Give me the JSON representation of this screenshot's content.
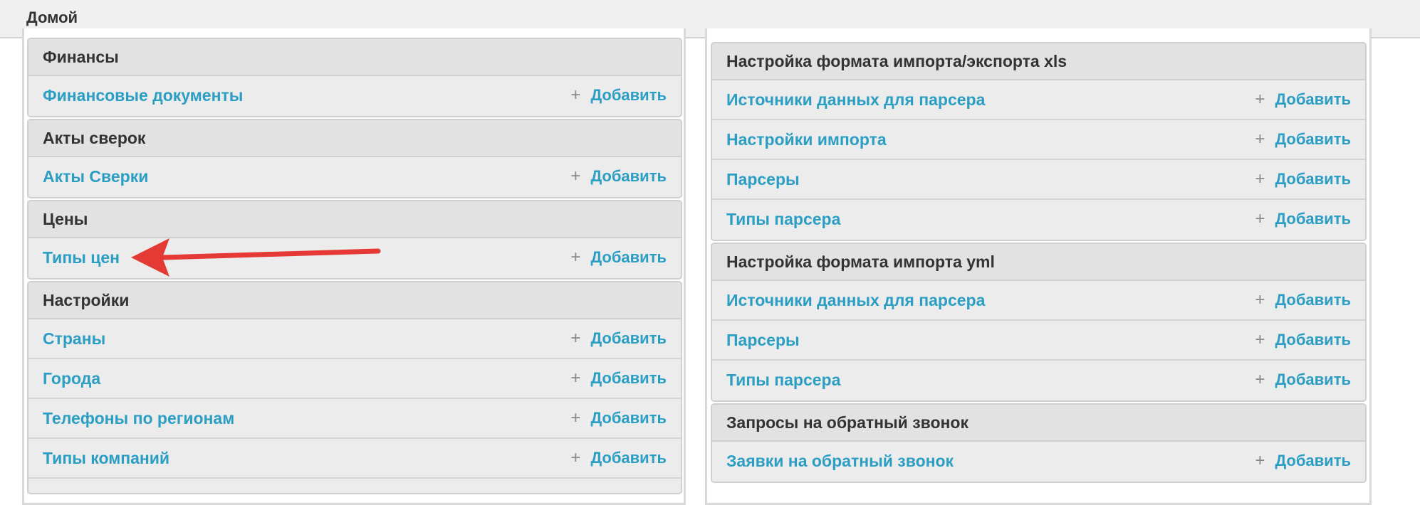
{
  "breadcrumb": "Домой",
  "add_label": "Добавить",
  "left": {
    "modules": [
      {
        "title": "Финансы",
        "rows": [
          "Финансовые документы"
        ]
      },
      {
        "title": "Акты сверок",
        "rows": [
          "Акты Сверки"
        ]
      },
      {
        "title": "Цены",
        "rows": [
          "Типы цен"
        ]
      },
      {
        "title": "Настройки",
        "rows": [
          "Страны",
          "Города",
          "Телефоны по регионам",
          "Типы компаний"
        ]
      }
    ]
  },
  "right": {
    "modules": [
      {
        "title": "Настройка формата импорта/экспорта xls",
        "rows": [
          "Источники данных для парсера",
          "Настройки импорта",
          "Парсеры",
          "Типы парсера"
        ]
      },
      {
        "title": "Настройка формата импорта yml",
        "rows": [
          "Источники данных для парсера",
          "Парсеры",
          "Типы парсера"
        ]
      },
      {
        "title": "Запросы на обратный звонок",
        "rows": [
          "Заявки на обратный звонок"
        ]
      }
    ]
  },
  "colors": {
    "link": "#2b9ec4",
    "arrow": "#e53935"
  }
}
